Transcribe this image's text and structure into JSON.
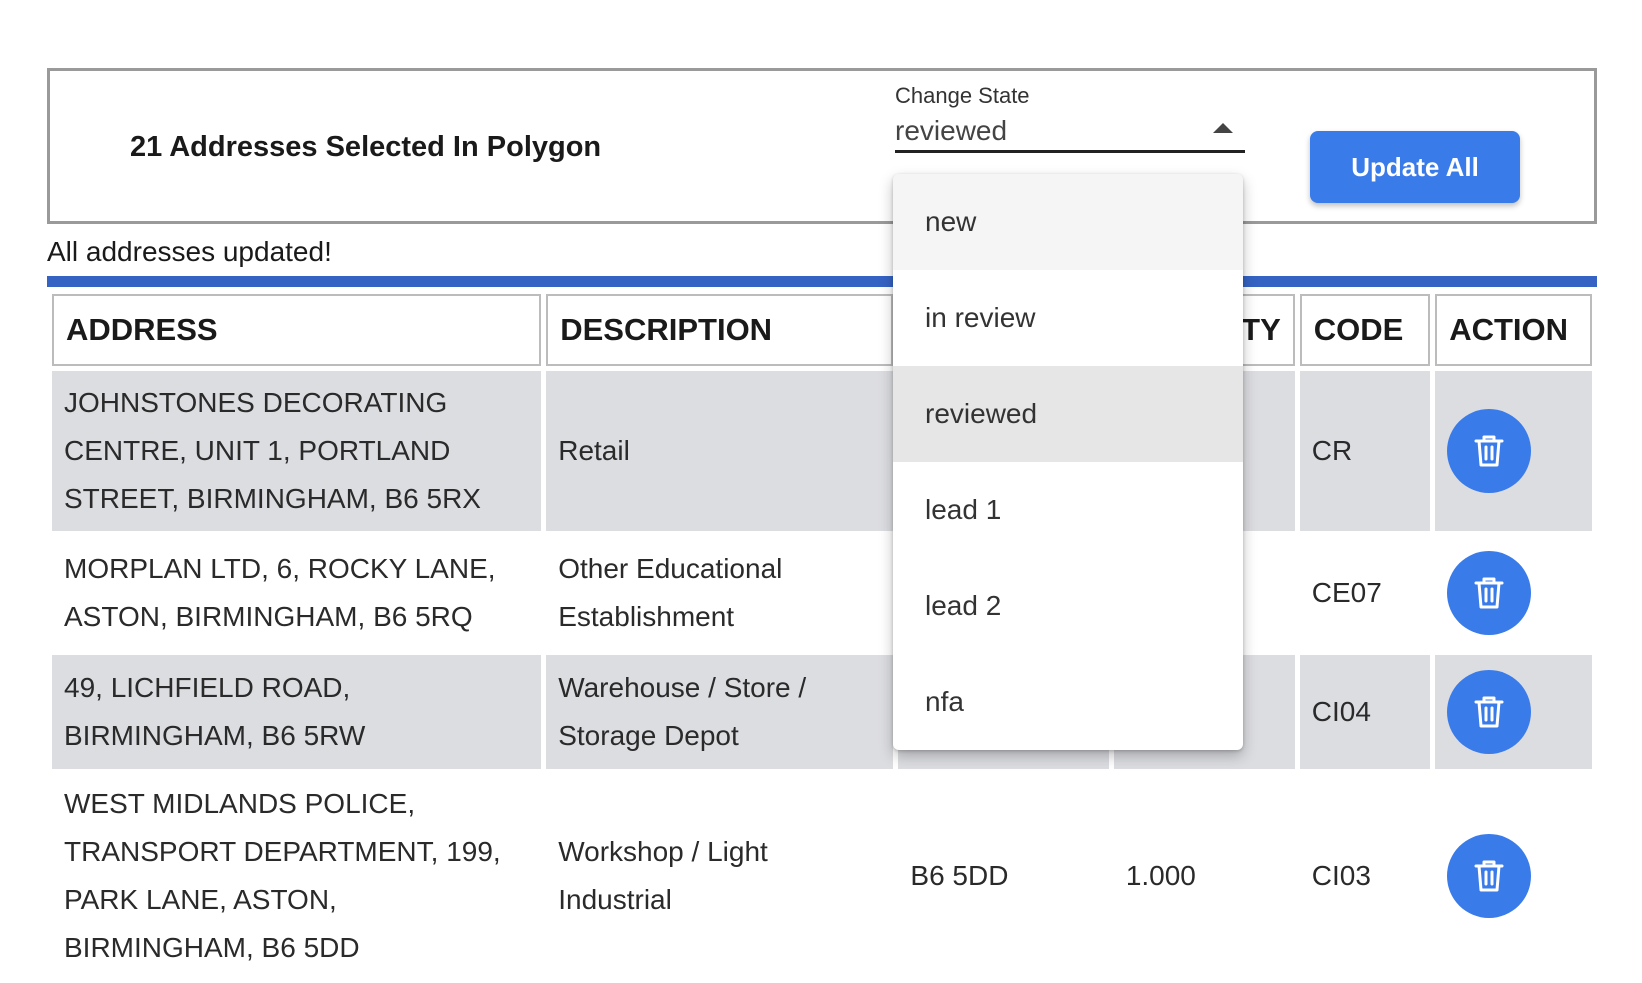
{
  "panel": {
    "title": "21 Addresses Selected In Polygon",
    "change_state_label": "Change State",
    "selected_state": "reviewed",
    "update_button": "Update All"
  },
  "status_message": "All addresses updated!",
  "table": {
    "columns": [
      "ADDRESS",
      "DESCRIPTION",
      "",
      "TY",
      "CODE",
      "ACTION"
    ],
    "rows": [
      {
        "address": "JOHNSTONES DECORATING CENTRE, UNIT 1, PORTLAND STREET, BIRMINGHAM, B6 5RX",
        "description": "Retail",
        "postcode": "",
        "quantity": "",
        "code": "CR"
      },
      {
        "address": "MORPLAN LTD, 6, ROCKY LANE, ASTON, BIRMINGHAM, B6 5RQ",
        "description": "Other Educational Establishment",
        "postcode": "",
        "quantity": "",
        "code": "CE07"
      },
      {
        "address": "49, LICHFIELD ROAD, BIRMINGHAM, B6 5RW",
        "description": "Warehouse / Store / Storage Depot",
        "postcode": "",
        "quantity": "",
        "code": "CI04"
      },
      {
        "address": "WEST MIDLANDS POLICE, TRANSPORT DEPARTMENT, 199, PARK LANE, ASTON, BIRMINGHAM, B6 5DD",
        "description": "Workshop / Light Industrial",
        "postcode": "B6 5DD",
        "quantity": "1.000",
        "code": "CI03"
      }
    ]
  },
  "dropdown": {
    "options": [
      "new",
      "in review",
      "reviewed",
      "lead 1",
      "lead 2",
      "nfa"
    ]
  },
  "colors": {
    "accent": "#3a7bea",
    "rule": "#3563c4",
    "row_shade": "#dcdde1"
  },
  "icons": {
    "delete": "trash-icon",
    "dropdown_arrow": "caret-up-icon"
  }
}
